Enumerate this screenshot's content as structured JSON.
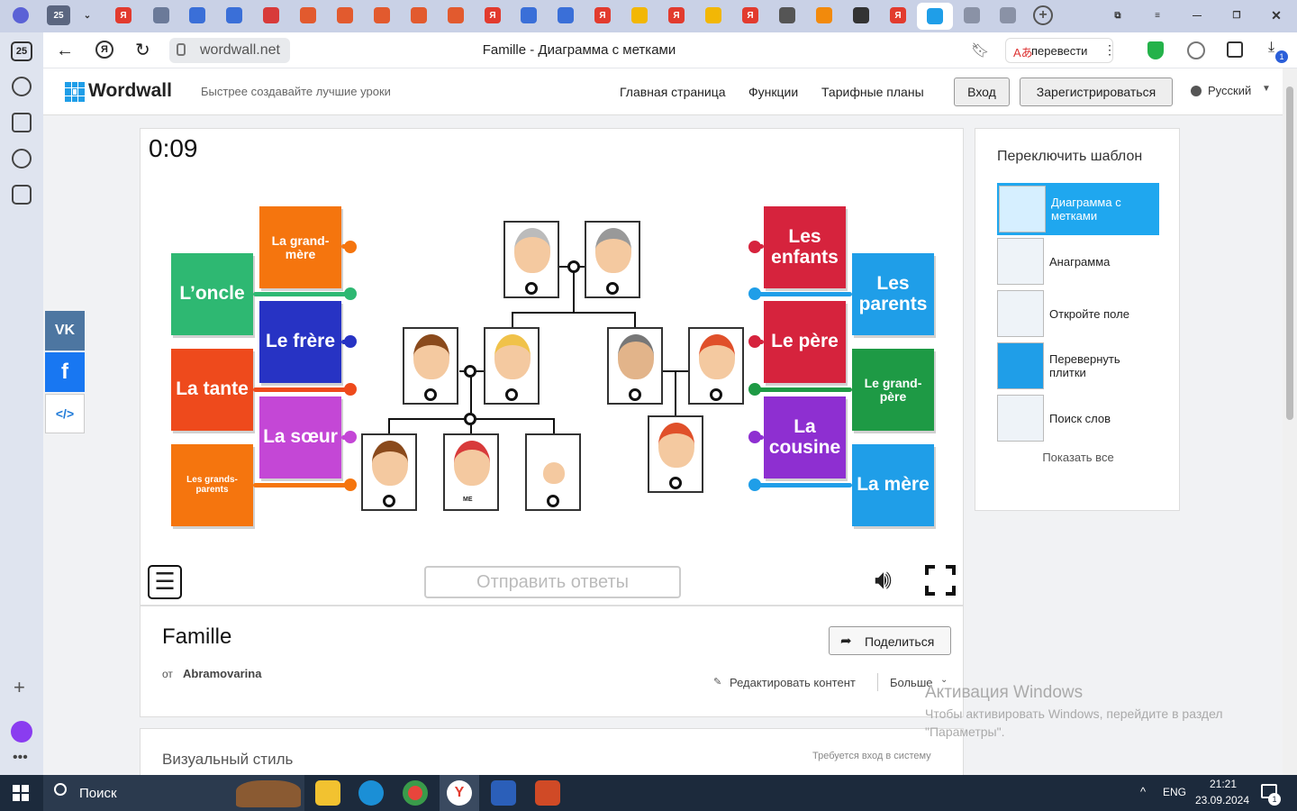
{
  "browser": {
    "badge_count": "25",
    "url": "wordwall.net",
    "page_title": "Famille - Диаграмма с метками",
    "translate_label": "перевести",
    "downloads_badge": "1"
  },
  "site": {
    "logo": "Wordwall",
    "tagline": "Быстрее создавайте лучшие уроки",
    "nav": [
      "Главная страница",
      "Функции",
      "Тарифные планы"
    ],
    "login": "Вход",
    "register": "Зарегистрироваться",
    "language": "Русский"
  },
  "game": {
    "timer": "0:09",
    "submit": "Отправить ответы",
    "labels_left": [
      {
        "text": "La grand-mère",
        "color": "#f5750e"
      },
      {
        "text": "L’oncle",
        "color": "#2eb872"
      },
      {
        "text": "Le frère",
        "color": "#2733c4"
      },
      {
        "text": "La tante",
        "color": "#ee4a1c"
      },
      {
        "text": "La sœur",
        "color": "#c447d6"
      },
      {
        "text": "Les grands-parents",
        "color": "#f5750e"
      }
    ],
    "labels_right": [
      {
        "text": "Les enfants",
        "color": "#d6233d"
      },
      {
        "text": "Les parents",
        "color": "#1f9ee8"
      },
      {
        "text": "Le père",
        "color": "#d6233d"
      },
      {
        "text": "Le grand-père",
        "color": "#1e9a45"
      },
      {
        "text": "La cousine",
        "color": "#8e2fd1"
      },
      {
        "text": "La mère",
        "color": "#1f9ee8"
      }
    ],
    "me_tag": "ME"
  },
  "info": {
    "title": "Famille",
    "by_prefix": "от",
    "author": "Abramovarina",
    "share": "Поделиться",
    "edit": "Редактировать контент",
    "more": "Больше",
    "visual_style": "Визуальный стиль",
    "login_required": "Требуется вход в систему"
  },
  "sidebar": {
    "heading": "Переключить шаблон",
    "templates": [
      "Диаграмма с метками",
      "Анаграмма",
      "Откройте поле",
      "Перевернуть плитки",
      "Поиск слов"
    ],
    "show_all": "Показать все"
  },
  "watermark": {
    "title": "Активация Windows",
    "line": "Чтобы активировать Windows, перейдите в раздел \"Параметры\"."
  },
  "taskbar": {
    "search": "Поиск",
    "lang": "ENG",
    "time": "21:21",
    "date": "23.09.2024",
    "notif": "1"
  }
}
